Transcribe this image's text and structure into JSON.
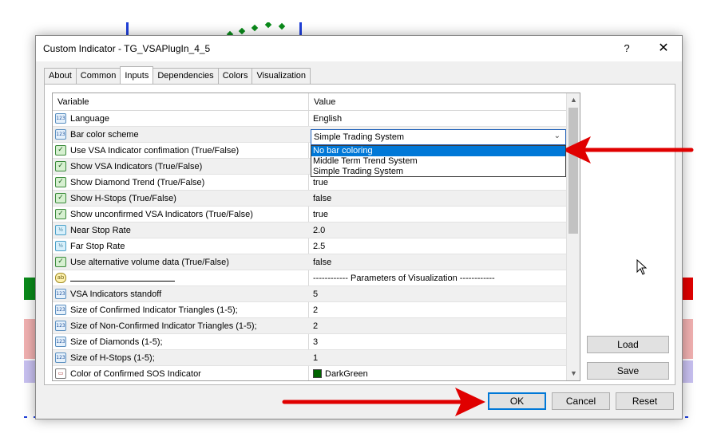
{
  "window": {
    "title": "Custom Indicator - TG_VSAPlugIn_4_5",
    "help_label": "?",
    "close_label": "✕"
  },
  "tabs": [
    {
      "label": "About",
      "active": false
    },
    {
      "label": "Common",
      "active": false
    },
    {
      "label": "Inputs",
      "active": true
    },
    {
      "label": "Dependencies",
      "active": false
    },
    {
      "label": "Colors",
      "active": false
    },
    {
      "label": "Visualization",
      "active": false
    }
  ],
  "grid": {
    "header_variable": "Variable",
    "header_value": "Value",
    "rows": [
      {
        "icon": "int",
        "name": "Language",
        "value": "English"
      },
      {
        "icon": "int",
        "name": "Bar color scheme",
        "value": "Simple Trading System"
      },
      {
        "icon": "bool",
        "name": "Use VSA Indicator confimation (True/False)",
        "value": ""
      },
      {
        "icon": "bool",
        "name": "Show VSA Indicators (True/False)",
        "value": ""
      },
      {
        "icon": "bool",
        "name": "Show Diamond Trend (True/False)",
        "value": "true"
      },
      {
        "icon": "bool",
        "name": "Show H-Stops (True/False)",
        "value": "false"
      },
      {
        "icon": "bool",
        "name": "Show unconfirmed VSA Indicators (True/False)",
        "value": "true"
      },
      {
        "icon": "double",
        "name": "Near Stop Rate",
        "value": "2.0"
      },
      {
        "icon": "double",
        "name": "Far Stop Rate",
        "value": "2.5"
      },
      {
        "icon": "bool",
        "name": "Use alternative volume data (True/False)",
        "value": "false"
      },
      {
        "icon": "string",
        "name": "",
        "value": "------------ Parameters of Visualization ------------"
      },
      {
        "icon": "int",
        "name": "VSA Indicators standoff",
        "value": "5"
      },
      {
        "icon": "int",
        "name": "Size of Confirmed Indicator Triangles (1-5);",
        "value": "2"
      },
      {
        "icon": "int",
        "name": "Size of Non-Confirmed Indicator Triangles (1-5);",
        "value": "2"
      },
      {
        "icon": "int",
        "name": "Size of Diamonds (1-5);",
        "value": "3"
      },
      {
        "icon": "int",
        "name": "Size of H-Stops (1-5);",
        "value": "1"
      },
      {
        "icon": "color",
        "name": "Color of Confirmed SOS Indicator",
        "value": "DarkGreen"
      }
    ]
  },
  "icons": {
    "int": "123",
    "bool": "✓",
    "double": "½",
    "string": "ab",
    "color": "▭"
  },
  "dropdown": {
    "selected_value": "Simple Trading System",
    "options": [
      "No bar coloring",
      "Middle Term Trend System",
      "Simple Trading System"
    ],
    "highlighted": "No bar coloring"
  },
  "buttons": {
    "load": "Load",
    "save": "Save",
    "ok": "OK",
    "cancel": "Cancel",
    "reset": "Reset"
  },
  "colors": {
    "highlight": "#0078d7",
    "arrow_red": "#e00000",
    "swatch_darkgreen": "#006400"
  }
}
